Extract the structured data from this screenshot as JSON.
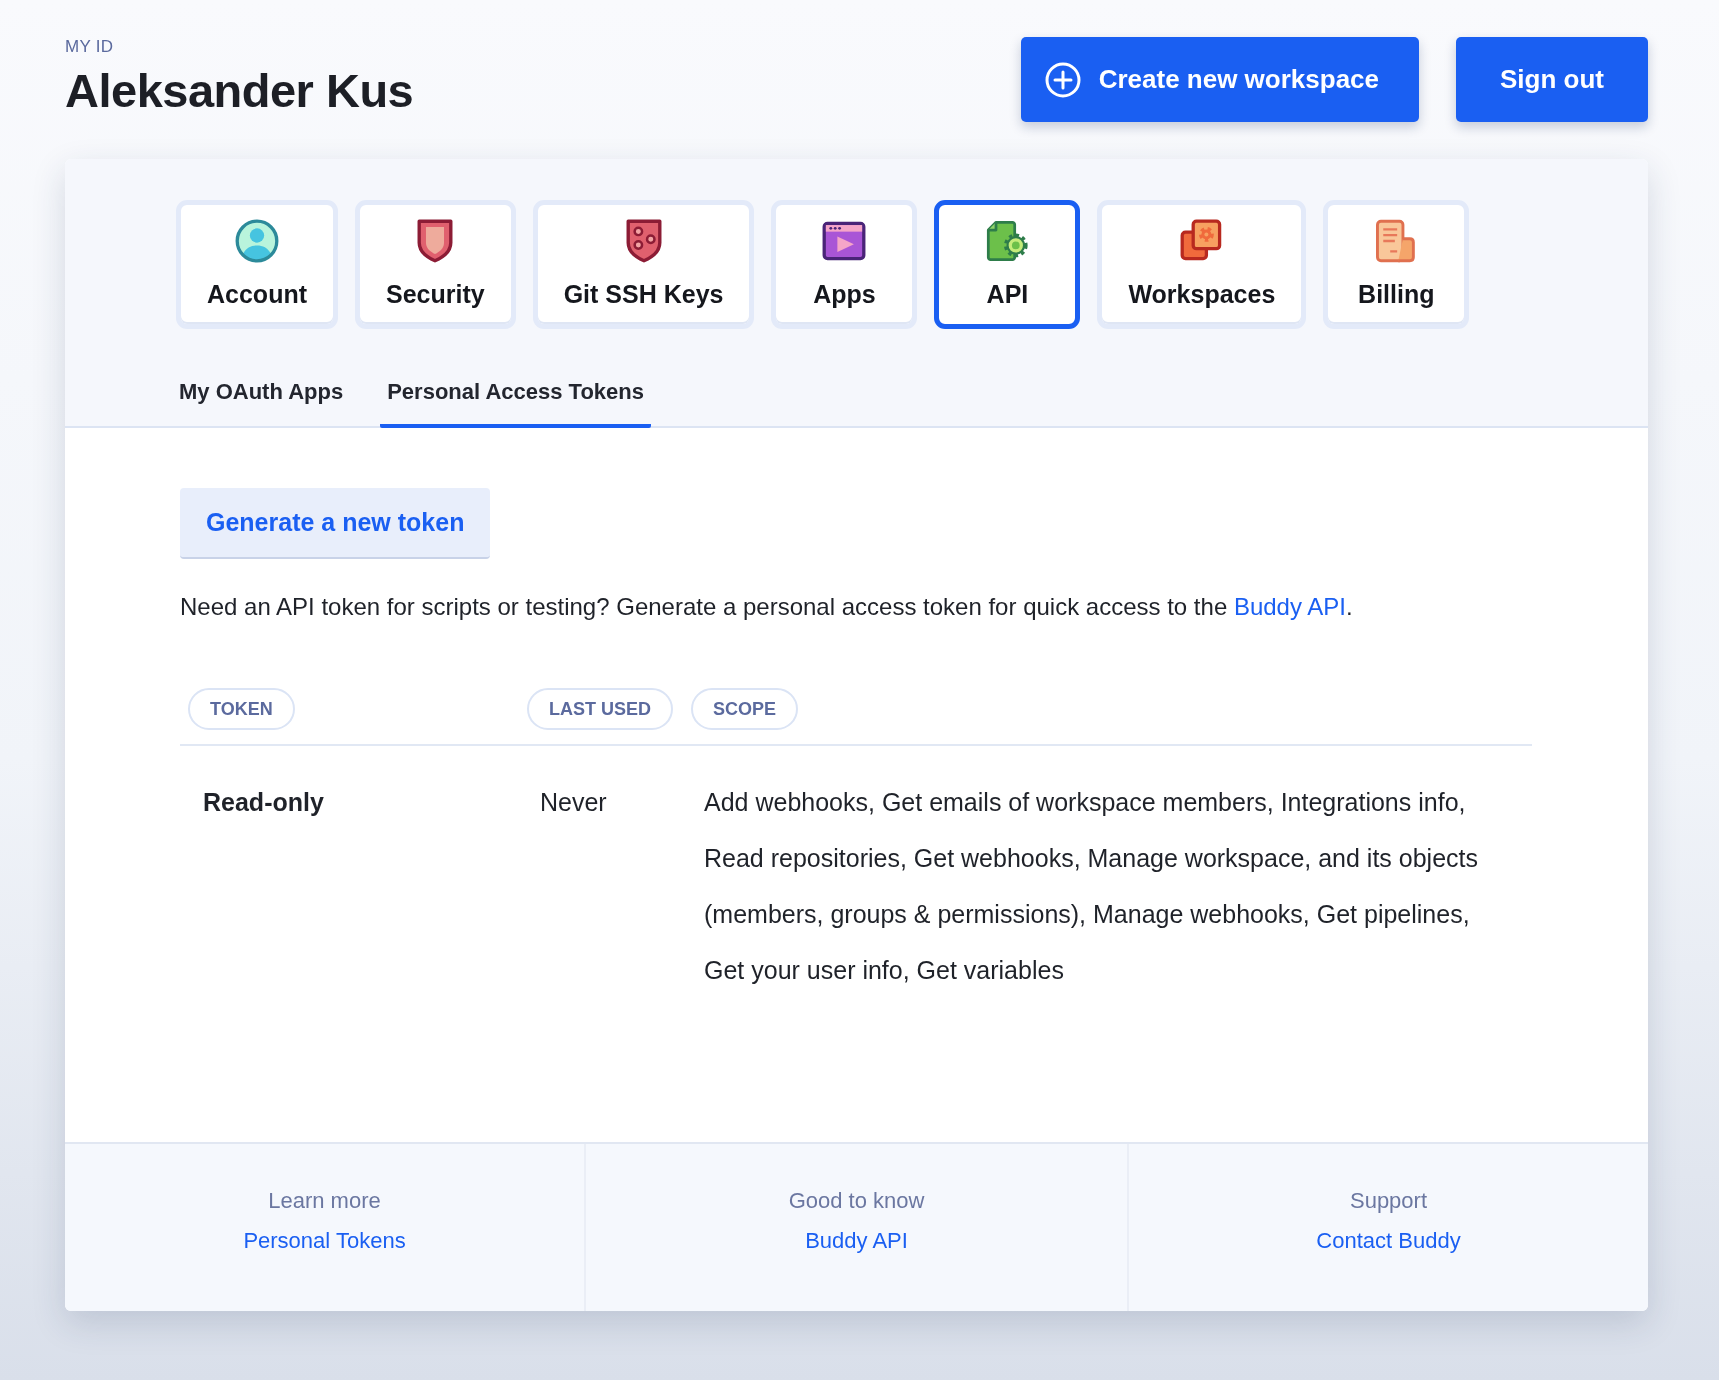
{
  "header": {
    "caption": "MY ID",
    "name": "Aleksander Kus",
    "buttons": [
      {
        "label": "Create new workspace",
        "kind": "create"
      },
      {
        "label": "Sign out",
        "kind": "plain"
      }
    ]
  },
  "nav_tiles": [
    {
      "label": "Account",
      "kind": "account",
      "selected": false
    },
    {
      "label": "Security",
      "kind": "security",
      "selected": false
    },
    {
      "label": "Git SSH Keys",
      "kind": "keys",
      "selected": false
    },
    {
      "label": "Apps",
      "kind": "apps",
      "selected": false
    },
    {
      "label": "API",
      "kind": "api",
      "selected": true
    },
    {
      "label": "Workspaces",
      "kind": "workspaces",
      "selected": false
    },
    {
      "label": "Billing",
      "kind": "billing",
      "selected": false
    }
  ],
  "subtabs": [
    {
      "label": "My OAuth Apps",
      "selected": false
    },
    {
      "label": "Personal Access Tokens",
      "selected": true
    }
  ],
  "generate_button": "Generate a new token",
  "intro": {
    "text": "Need an API token for scripts or testing? Generate a personal access token for quick access to the ",
    "link": "Buddy API",
    "end": "."
  },
  "table": {
    "columns": [
      "TOKEN",
      "LAST USED",
      "SCOPE"
    ],
    "rows": [
      {
        "token": "Read-only",
        "last_used": "Never",
        "scope": "Add webhooks, Get emails of workspace members, Integrations info, Read repositories, Get webhooks, Manage workspace, and its objects (members, groups & permissions), Manage webhooks, Get pipelines, Get your user info, Get variables"
      }
    ]
  },
  "footer": [
    {
      "label": "Learn more",
      "link": "Personal Tokens"
    },
    {
      "label": "Good to know",
      "link": "Buddy API"
    },
    {
      "label": "Support",
      "link": "Contact Buddy"
    }
  ]
}
